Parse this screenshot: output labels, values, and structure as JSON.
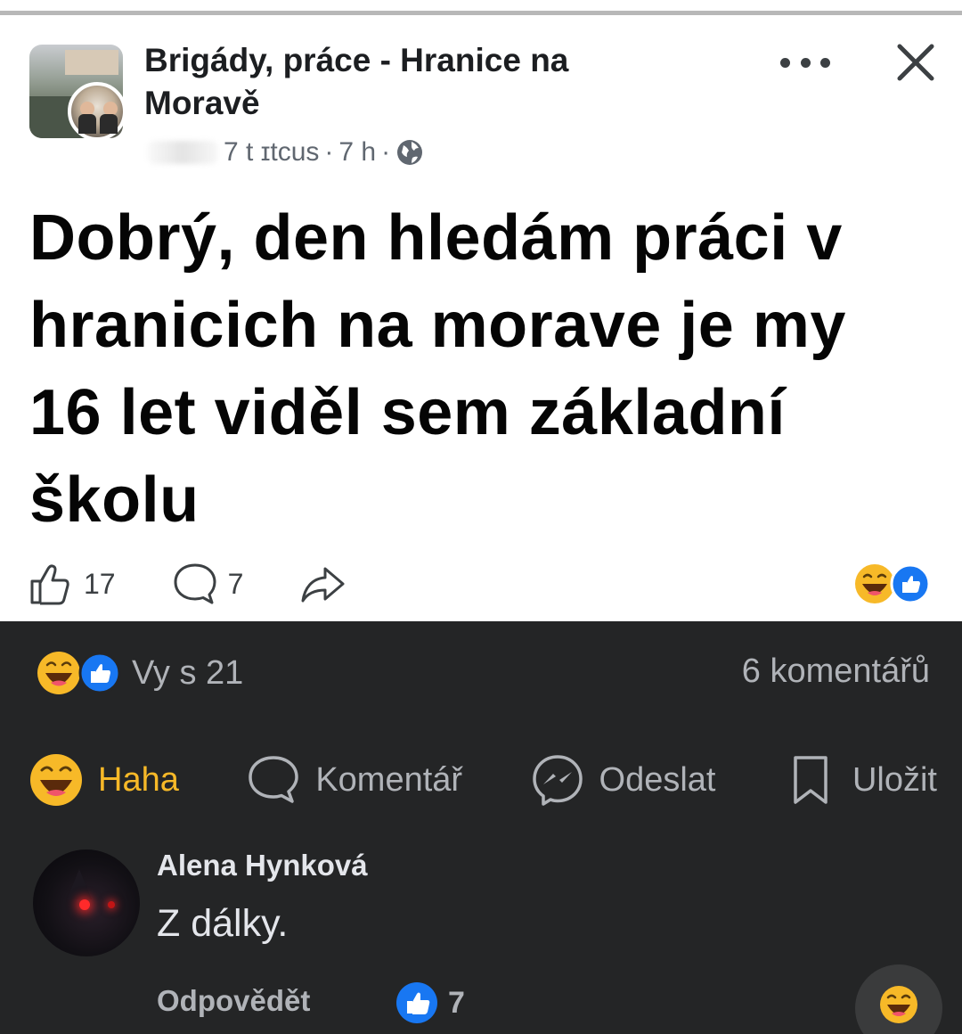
{
  "post": {
    "group_name": "Brigády, práce - Hranice na Moravě",
    "author_fragment": "7 t ɪtcus",
    "time": "7 h",
    "separator": "·",
    "body": "Dobrý, den hledám práci v hranicich na morave  je my 16 let viděl sem základní školu",
    "like_count": "17",
    "comment_count": "7"
  },
  "reactions": {
    "summary": "Vy s 21",
    "comments_label": "6 komentářů"
  },
  "actions": {
    "haha": "Haha",
    "comment": "Komentář",
    "send": "Odeslat",
    "save": "Uložit"
  },
  "comment": {
    "author": "Alena Hynková",
    "text": "Z dálky.",
    "reply": "Odpovědět",
    "likes": "7"
  },
  "icons": [
    "globe-icon",
    "more-icon",
    "close-icon",
    "like-icon",
    "comment-icon",
    "share-icon",
    "haha-icon",
    "messenger-icon",
    "bookmark-icon"
  ],
  "colors": {
    "dark_bg": "#242526",
    "haha_yellow": "#f7b928",
    "like_blue": "#1877f2",
    "muted_text": "#b0b3b8"
  }
}
